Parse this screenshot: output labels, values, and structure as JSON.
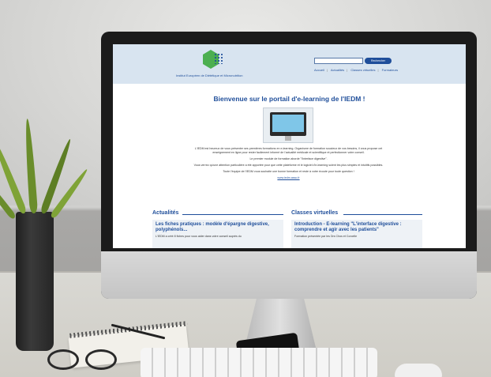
{
  "header": {
    "logo_text": "Institut Européen de Diététique et Micronutrition",
    "search_placeholder": "",
    "search_button": "Rechercher",
    "nav": [
      "Accueil",
      "Actualités",
      "Classes virtuelles",
      "Formateurs"
    ]
  },
  "main": {
    "title": "Bienvenue sur le portail d'e-learning de l'IEDM !",
    "intro_paragraphs": [
      "L'IEDM est heureux de vous présenter ses premières formations en e-learning. Organisme de formation soucieux de vos besoins, il vous propose cet enseignement en ligne pour rester facilement informé de l'actualité médicale et scientifique et perfectionner votre conseil.",
      "Le premier module de formation aborde \"l'interface digestive\".",
      "Vous verrez qu'une attention particulière a été apportée pour que cette plateforme et le logiciel d'e-learning soient les plus simples et intuitifs possibles.",
      "Toute l'équipe de l'IEDM vous souhaite une bonne formation et reste à votre écoute pour toute question !"
    ],
    "link": "www.iedm.asso.fr"
  },
  "sections": {
    "news": {
      "heading": "Actualités",
      "card_title": "Les fiches pratiques : modèle d'épargne digestive, polyphénols...",
      "card_text": "L'IEDM a créé 8 fiches pour vous aider dans votre conseil auprès du"
    },
    "classes": {
      "heading": "Classes virtuelles",
      "card_title": "Introduction - E-learning \"L'interface digestive : comprendre et agir avec les patients\"",
      "card_text": "Formation présentée par les Drs Chos et Corcelle"
    }
  },
  "colors": {
    "brand_blue": "#1f4e9a",
    "logo_green": "#4caf50",
    "header_bg": "#d8e4f0"
  }
}
